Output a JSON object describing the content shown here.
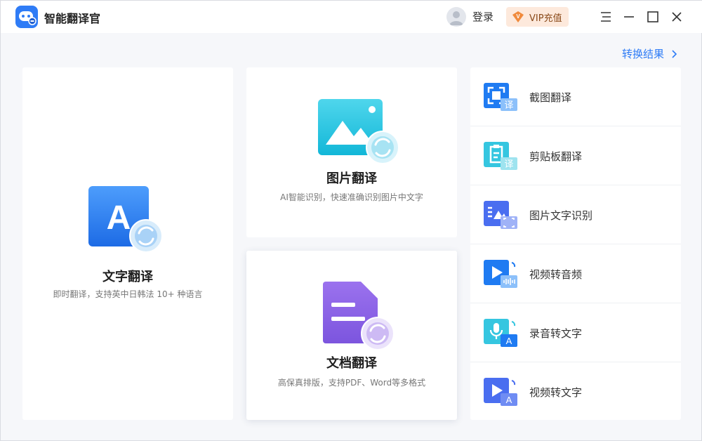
{
  "app": {
    "title": "智能翻译官"
  },
  "header": {
    "login_label": "登录",
    "vip_label": "VIP充值",
    "vip_badge_letter": "V"
  },
  "main": {
    "convert_results": "转换结果",
    "cards": {
      "text": {
        "title": "文字翻译",
        "desc": "即时翻译，支持英中日韩法 10+ 种语言",
        "icon_letter": "A"
      },
      "image": {
        "title": "图片翻译",
        "desc": "AI智能识别，快速准确识别图片中文字"
      },
      "doc": {
        "title": "文档翻译",
        "desc": "高保真排版，支持PDF、Word等多格式"
      }
    },
    "side_items": [
      {
        "label": "截图翻译",
        "badge": "译"
      },
      {
        "label": "剪贴板翻译",
        "badge": "译"
      },
      {
        "label": "图片文字识别"
      },
      {
        "label": "视频转音频"
      },
      {
        "label": "录音转文字",
        "badge": "A"
      },
      {
        "label": "视频转文字",
        "badge": "A"
      }
    ]
  },
  "colors": {
    "accent": "#2f7cf6",
    "vip_bg": "#fde9dc",
    "doc_purple": "#8a63e6"
  }
}
